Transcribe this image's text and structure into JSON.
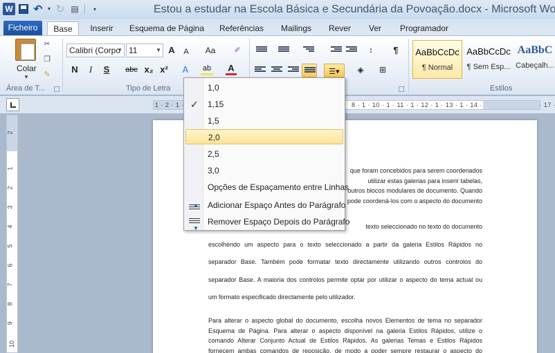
{
  "window": {
    "title": "Estou a estudar na Escola Básica e Secundária da Povoação.docx - Microsoft Word",
    "app_icon_letter": "W"
  },
  "tabs": {
    "file": "Ficheiro",
    "items": [
      "Base",
      "Inserir",
      "Esquema de Página",
      "Referências",
      "Mailings",
      "Rever",
      "Ver",
      "Programador"
    ],
    "active": "Base"
  },
  "ribbon": {
    "clipboard": {
      "paste_label": "Colar",
      "group_label": "Área de T..."
    },
    "font": {
      "name": "Calibri (Corpo",
      "size": "11",
      "group_label": "Tipo de Letra",
      "buttons": {
        "grow": "A",
        "shrink": "A",
        "case": "Aa",
        "bold": "N",
        "italic": "I",
        "underline": "S",
        "strike": "abc",
        "sub": "x₂",
        "sup": "x²",
        "effects": "A",
        "highlight": "ab",
        "color": "A"
      }
    },
    "paragraph": {
      "pilcrow": "¶"
    },
    "styles": {
      "group_label": "Estilos",
      "items": [
        {
          "preview": "AaBbCcDc",
          "name": "¶ Normal"
        },
        {
          "preview": "AaBbCcDc",
          "name": "¶ Sem Esp..."
        },
        {
          "preview": "AaBbC",
          "name": "Cabeçalh..."
        }
      ]
    }
  },
  "ruler": {
    "horizontal_text": "1 · 2 · 1 · 1 ·",
    "horizontal_text_right": "8 · 1 · 10 · 1 · 11 · 1 · 12 · 1 · 13 · 1 · 14 · 1 · 15 · 1 · 16 · 1 · 17 ·",
    "vertical_labels": [
      "2",
      "1",
      "2",
      "3",
      "4",
      "5",
      "6",
      "7",
      "8",
      "9",
      "10"
    ]
  },
  "line_spacing_menu": {
    "options": [
      "1,0",
      "1,15",
      "1,5",
      "2,0",
      "2,5",
      "3,0"
    ],
    "checked": "1,15",
    "hovered": "2,0",
    "more": "Opções de Espaçamento entre Linhas",
    "add_before": "Adicionar Espaço Antes do Parágrafo",
    "remove_after": "Remover Espaço Depois do Parágrafo"
  },
  "document": {
    "para1_lines": [
      "que foram concebidos para serem coordenados",
      "utilizar estas galerias para inserir tabelas,",
      "outros blocos modulares de documento. Quando",
      "pode coordená-los com o aspecto do documento"
    ],
    "para2_lines": [
      "texto seleccionado no texto do documento",
      "escolhendo um aspecto para o texto seleccionado a partir da galeria Estilos Rápidos no",
      "separador Base. Também pode formatar texto directamente utilizando outros controlos do",
      "separador Base. A maioria dos controlos permite optar por utilizar o aspecto do tema actual ou",
      "um formato especificado directamente pelo utilizador."
    ],
    "para3_lines": [
      "Para alterar o aspecto global do documento, escolha novos Elementos de tema no separador",
      "Esquema de Página. Para alterar o aspecto disponível na galeria Estilos Rápidos, utilize o",
      "comando Alterar Conjunto Actual de Estilos Rápidos. As galerias Temas e Estilos Rápidos",
      "fornecem ambas comandos de reposição, de modo a poder sempre restaurar o aspecto do"
    ]
  }
}
